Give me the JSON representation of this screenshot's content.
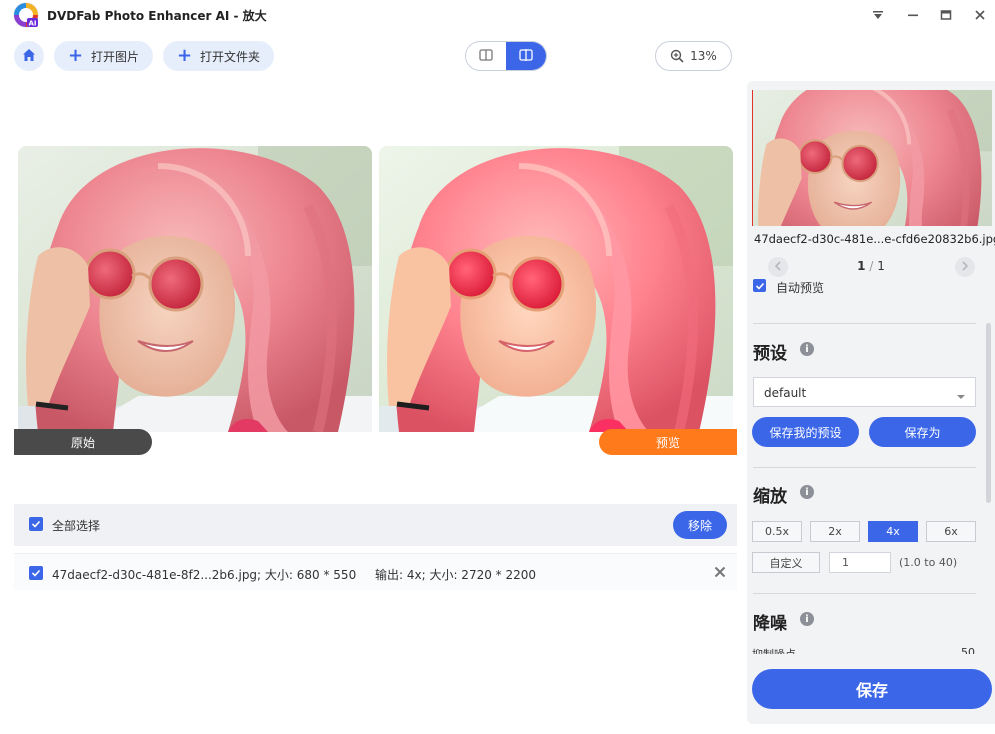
{
  "app": {
    "title": "DVDFab Photo Enhancer AI - 放大"
  },
  "toolbar": {
    "open_image": "打开图片",
    "open_folder": "打开文件夹",
    "zoom": "13%"
  },
  "preview": {
    "original_label": "原始",
    "preview_label": "预览"
  },
  "filelist": {
    "select_all": "全部选择",
    "remove": "移除",
    "row": {
      "name_size": "47daecf2-d30c-481e-8f2...2b6.jpg; 大小: 680 * 550",
      "output": "输出: 4x; 大小: 2720 * 2200"
    }
  },
  "panel": {
    "thumb_filename": "47daecf2-d30c-481e...e-cfd6e20832b6.jpg",
    "page_current": "1",
    "page_sep": "/",
    "page_total": "1",
    "auto_preview": "自动预览",
    "preset": {
      "title": "预设",
      "select_value": "default",
      "save_my_preset": "保存我的预设",
      "save_as": "保存为"
    },
    "scale": {
      "title": "缩放",
      "options": [
        "0.5x",
        "2x",
        "4x",
        "6x"
      ],
      "active_option": "4x",
      "custom_label": "自定义",
      "custom_value": "1",
      "range_hint": "(1.0 to 40)"
    },
    "denoise": {
      "title": "降噪",
      "sub_label": "抑制噪点",
      "value": "50"
    },
    "save": "保存"
  },
  "colors": {
    "accent": "#3b66e8",
    "original_tab": "#4a4a4a",
    "preview_tab": "#ff7a1a"
  },
  "icons": [
    "home-icon",
    "plus-icon",
    "split-view-icon",
    "side-by-side-icon",
    "zoom-in-icon",
    "info-icon",
    "checkbox-icon",
    "close-icon",
    "chevron-left-icon",
    "chevron-right-icon",
    "dropdown-arrow-icon"
  ]
}
